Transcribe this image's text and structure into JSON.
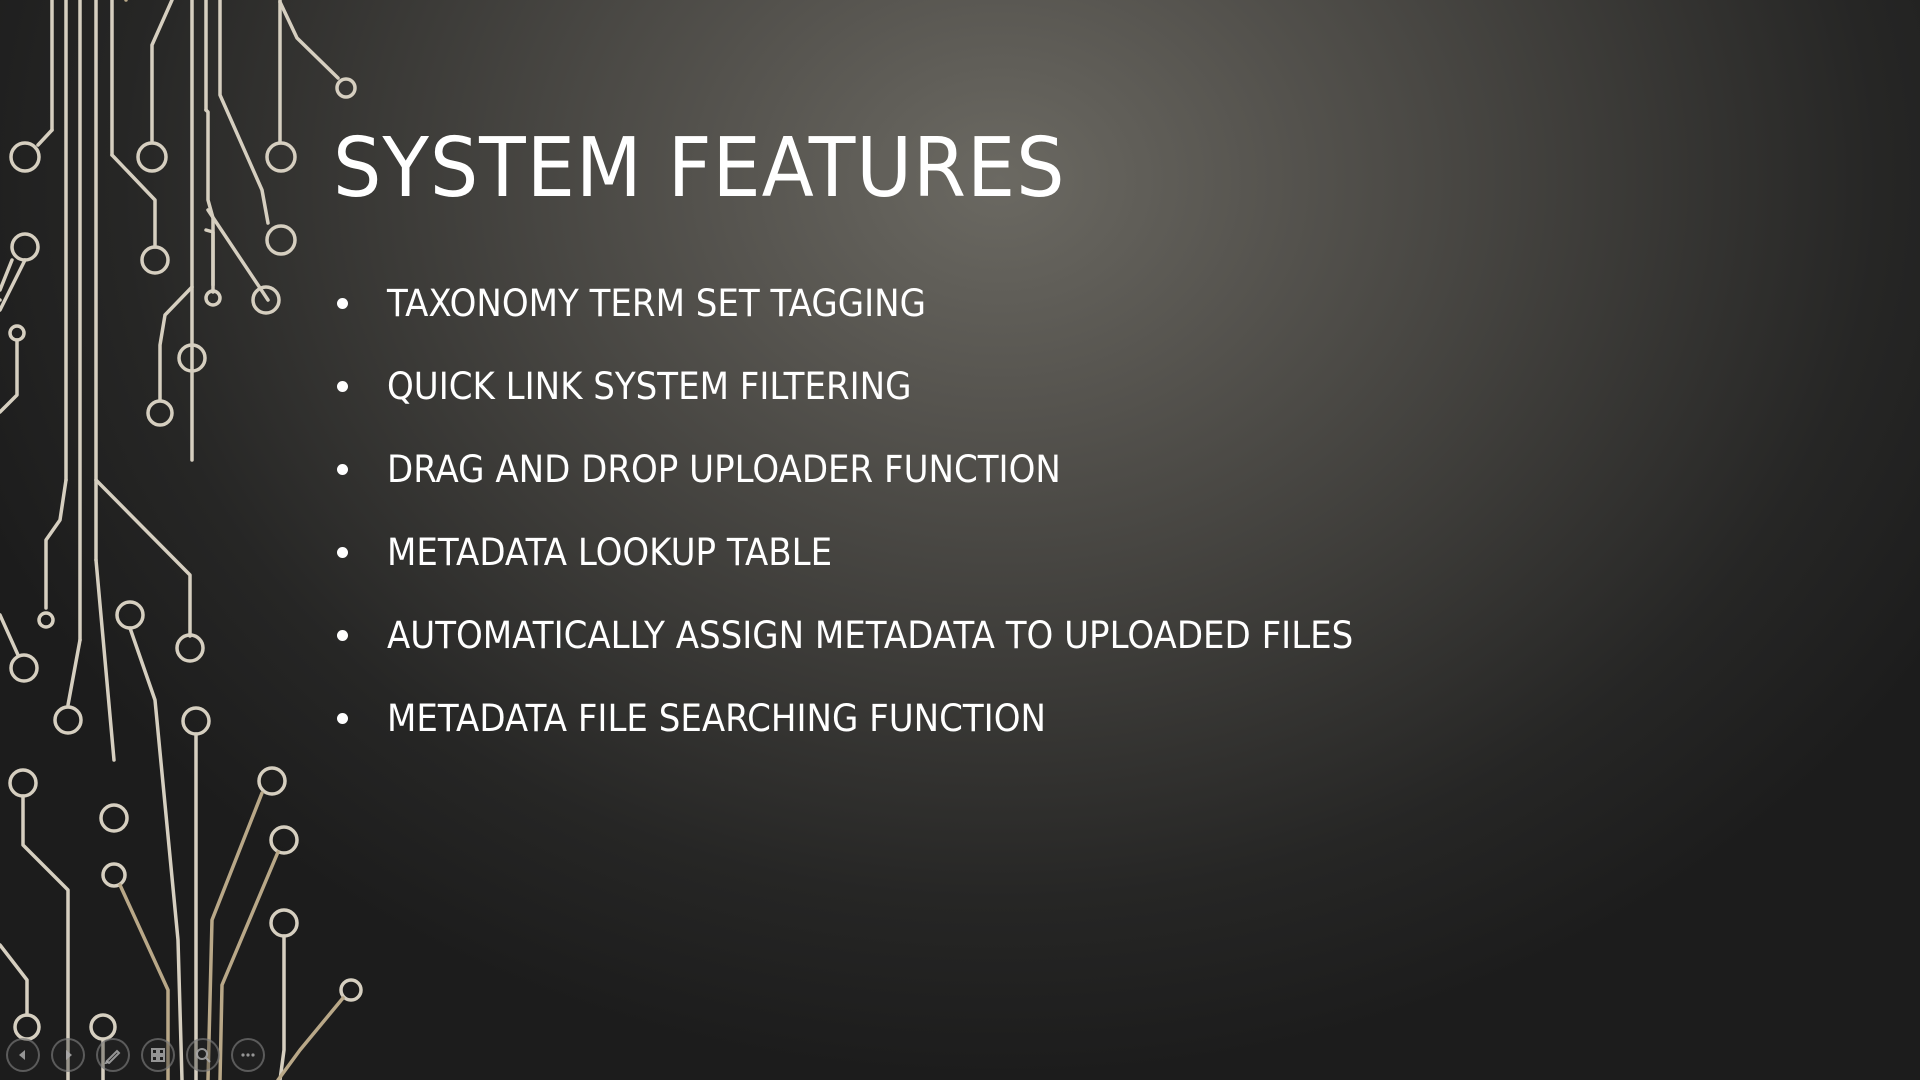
{
  "slide": {
    "title": "SYSTEM FEATURES",
    "bullets": [
      "TAXONOMY TERM SET TAGGING",
      "QUICK LINK SYSTEM FILTERING",
      "DRAG AND DROP UPLOADER FUNCTION",
      "METADATA LOOKUP TABLE",
      "AUTOMATICALLY ASSIGN METADATA TO UPLOADED FILES",
      "METADATA FILE SEARCHING FUNCTION"
    ]
  },
  "presenter_controls": [
    {
      "name": "previous-slide",
      "icon": "chevron-left-icon"
    },
    {
      "name": "next-slide",
      "icon": "chevron-right-icon"
    },
    {
      "name": "pen-tool",
      "icon": "pen-icon"
    },
    {
      "name": "see-all-slides",
      "icon": "grid-icon"
    },
    {
      "name": "zoom",
      "icon": "magnifier-icon"
    },
    {
      "name": "more-options",
      "icon": "ellipsis-icon"
    }
  ],
  "colors": {
    "circuit_light": "#d6cfc0",
    "circuit_tan": "#b9a888",
    "text": "#ffffff"
  }
}
